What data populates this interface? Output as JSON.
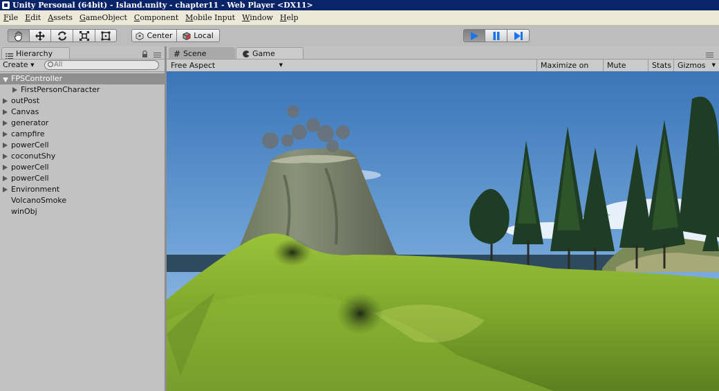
{
  "window": {
    "title": "Unity Personal (64bit) - Island.unity - chapter11 - Web Player <DX11>"
  },
  "menu": [
    "File",
    "Edit",
    "Assets",
    "GameObject",
    "Component",
    "Mobile Input",
    "Window",
    "Help"
  ],
  "toolbar": {
    "tools": [
      "hand-tool",
      "move-tool",
      "rotate-tool",
      "scale-tool",
      "rect-tool"
    ],
    "active_tool": "hand-tool",
    "pivot_mode": "Center",
    "pivot_rotation": "Local",
    "play_state": "playing"
  },
  "hierarchy": {
    "tab_label": "Hierarchy",
    "create_label": "Create",
    "search_placeholder": "All",
    "items": [
      {
        "label": "FPSController",
        "depth": 0,
        "expander": "expanded",
        "selected": true
      },
      {
        "label": "FirstPersonCharacter",
        "depth": 1,
        "expander": "collapsed",
        "selected": false
      },
      {
        "label": "outPost",
        "depth": 0,
        "expander": "collapsed",
        "selected": false
      },
      {
        "label": "Canvas",
        "depth": 0,
        "expander": "collapsed",
        "selected": false
      },
      {
        "label": "generator",
        "depth": 0,
        "expander": "collapsed",
        "selected": false
      },
      {
        "label": "campfire",
        "depth": 0,
        "expander": "collapsed",
        "selected": false
      },
      {
        "label": "powerCell",
        "depth": 0,
        "expander": "collapsed",
        "selected": false
      },
      {
        "label": "coconutShy",
        "depth": 0,
        "expander": "collapsed",
        "selected": false
      },
      {
        "label": "powerCell",
        "depth": 0,
        "expander": "collapsed",
        "selected": false
      },
      {
        "label": "powerCell",
        "depth": 0,
        "expander": "collapsed",
        "selected": false
      },
      {
        "label": "Environment",
        "depth": 0,
        "expander": "collapsed",
        "selected": false
      },
      {
        "label": "VolcanoSmoke",
        "depth": 0,
        "expander": "none",
        "selected": false
      },
      {
        "label": "winObj",
        "depth": 0,
        "expander": "none",
        "selected": false
      }
    ]
  },
  "tabs": {
    "scene": "Scene",
    "game": "Game",
    "active": "Game"
  },
  "game_toolbar": {
    "aspect": "Free Aspect",
    "maximize": "Maximize on Play",
    "mute": "Mute audio",
    "stats": "Stats",
    "gizmos": "Gizmos"
  },
  "colors": {
    "title_bar": "#0a246a",
    "menu_bar": "#ece9d8",
    "editor_bg": "#c2c2c2",
    "selection": "#8f8f8f",
    "play_accent": "#1a73e8"
  }
}
